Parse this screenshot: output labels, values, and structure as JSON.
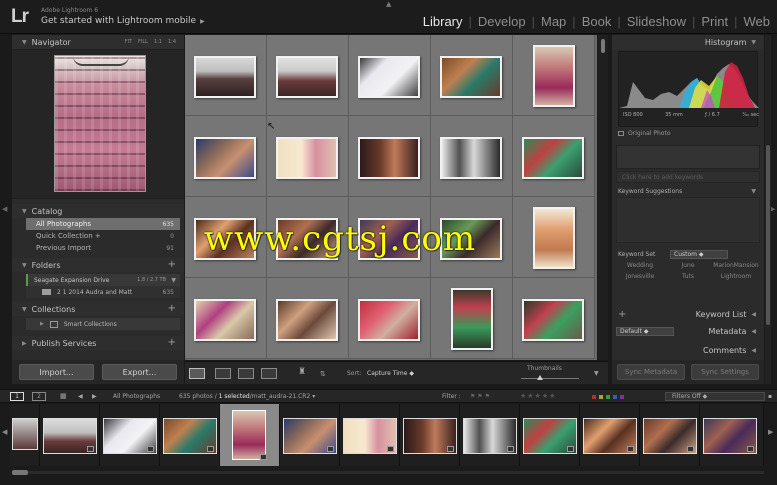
{
  "app": {
    "logo": "Lr",
    "name": "Adobe Lightroom 6",
    "mobile_link": "Get started with Lightroom mobile"
  },
  "modules": [
    {
      "label": "Library",
      "active": true
    },
    {
      "label": "Develop",
      "active": false
    },
    {
      "label": "Map",
      "active": false
    },
    {
      "label": "Book",
      "active": false
    },
    {
      "label": "Slideshow",
      "active": false
    },
    {
      "label": "Print",
      "active": false
    },
    {
      "label": "Web",
      "active": false
    }
  ],
  "left_panel": {
    "navigator": {
      "title": "Navigator",
      "zoom": [
        "FIT",
        "FILL",
        "1:1",
        "1:4"
      ]
    },
    "catalog": {
      "title": "Catalog",
      "items": [
        {
          "label": "All Photographs",
          "count": "635",
          "selected": true
        },
        {
          "label": "Quick Collection +",
          "count": "0"
        },
        {
          "label": "Previous Import",
          "count": "91"
        }
      ]
    },
    "folders": {
      "title": "Folders",
      "drive": {
        "label": "Seagate Expansion Drive",
        "size": "1.8 / 2.7 TB"
      },
      "items": [
        {
          "label": "2 1 2014 Audra and Matt",
          "count": "635"
        }
      ]
    },
    "collections": {
      "title": "Collections",
      "items": [
        {
          "label": "Smart Collections"
        }
      ]
    },
    "publish": {
      "title": "Publish Services"
    },
    "import_label": "Import...",
    "export_label": "Export..."
  },
  "toolbar": {
    "sort_label": "Sort:",
    "sort_value": "Capture Time",
    "thumbnails_label": "Thumbnails"
  },
  "right_panel": {
    "histogram": {
      "title": "Histogram",
      "iso": "ISO 800",
      "focal": "35 mm",
      "aperture": "ƒ / 6.7",
      "shutter": "¹⁄₆₀ sec"
    },
    "original_photo": "Original Photo",
    "keywords_placeholder": "Click here to add keywords",
    "keyword_suggestions": "Keyword Suggestions",
    "keyword_set": {
      "label": "Keyword Set",
      "value": "Custom",
      "items": [
        "Wedding",
        "June",
        "MarionMansion",
        "Jonesville",
        "Tuts",
        "Lightroom"
      ]
    },
    "keyword_list": "Keyword List",
    "metadata": {
      "label": "Metadata",
      "preset": "Default"
    },
    "comments": "Comments",
    "sync_metadata": "Sync Metadata",
    "sync_settings": "Sync Settings"
  },
  "filmstrip_bar": {
    "page1": "1",
    "page2": "2",
    "source": "All Photographs",
    "count": "635 photos /",
    "selected": "1 selected",
    "file": "/matt_audra-21.CR2",
    "filter_label": "Filter :",
    "filters_value": "Filters Off"
  },
  "watermark": "www.cgtsj.com",
  "colors": {
    "accent_yellow": "#ffff00",
    "panel_bg": "#2b2b2b",
    "grid_bg": "#6b6b6b"
  }
}
